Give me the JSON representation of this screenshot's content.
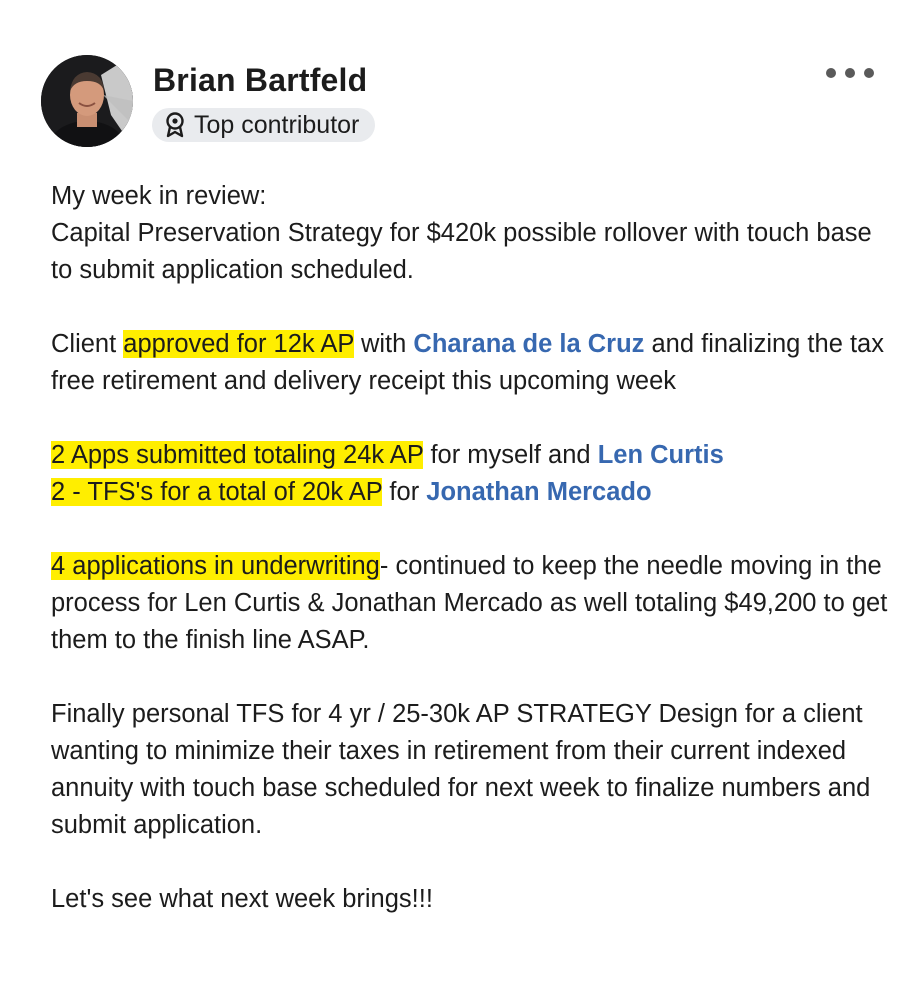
{
  "author": {
    "name": "Brian Bartfeld",
    "badge_label": "Top contributor",
    "badge_icon": "award-ribbon-icon",
    "avatar_icon": "profile-photo"
  },
  "menu": {
    "icon": "more-options-icon"
  },
  "post": {
    "p1": {
      "line1": "My week in review:",
      "line2": "Capital Preservation Strategy for $420k possible rollover with touch base to submit application scheduled."
    },
    "p2": {
      "t1": "Client ",
      "hl1": "approved for 12k AP",
      "t2": " with ",
      "mention1": "Charana de la Cruz",
      "t3": " and finalizing the tax free retirement and delivery receipt this upcoming week"
    },
    "p3": {
      "hl1": "2 Apps submitted totaling 24k AP",
      "t1": " for myself and ",
      "mention1": "Len Curtis",
      "hl2": "2 - TFS's for a total of 20k AP",
      "t2": " for ",
      "mention2": "Jonathan Mercado"
    },
    "p4": {
      "hl1": "4 applications in underwriting",
      "t1": "- continued to keep the needle moving in the process for Len Curtis & Jonathan Mercado as well totaling $49,200 to get them to the finish line ASAP."
    },
    "p5": {
      "t1": "Finally personal TFS for 4 yr / 25-30k AP STRATEGY Design for a client wanting to minimize their taxes in retirement from their current indexed annuity with touch base scheduled for next week to finalize numbers and submit application."
    },
    "p6": {
      "t1": "Let's see what next week brings!!!"
    }
  },
  "colors": {
    "highlight": "#ffee00",
    "mention": "#3768b0",
    "text": "#1c1c1c",
    "badge_bg": "#e9ebee"
  }
}
